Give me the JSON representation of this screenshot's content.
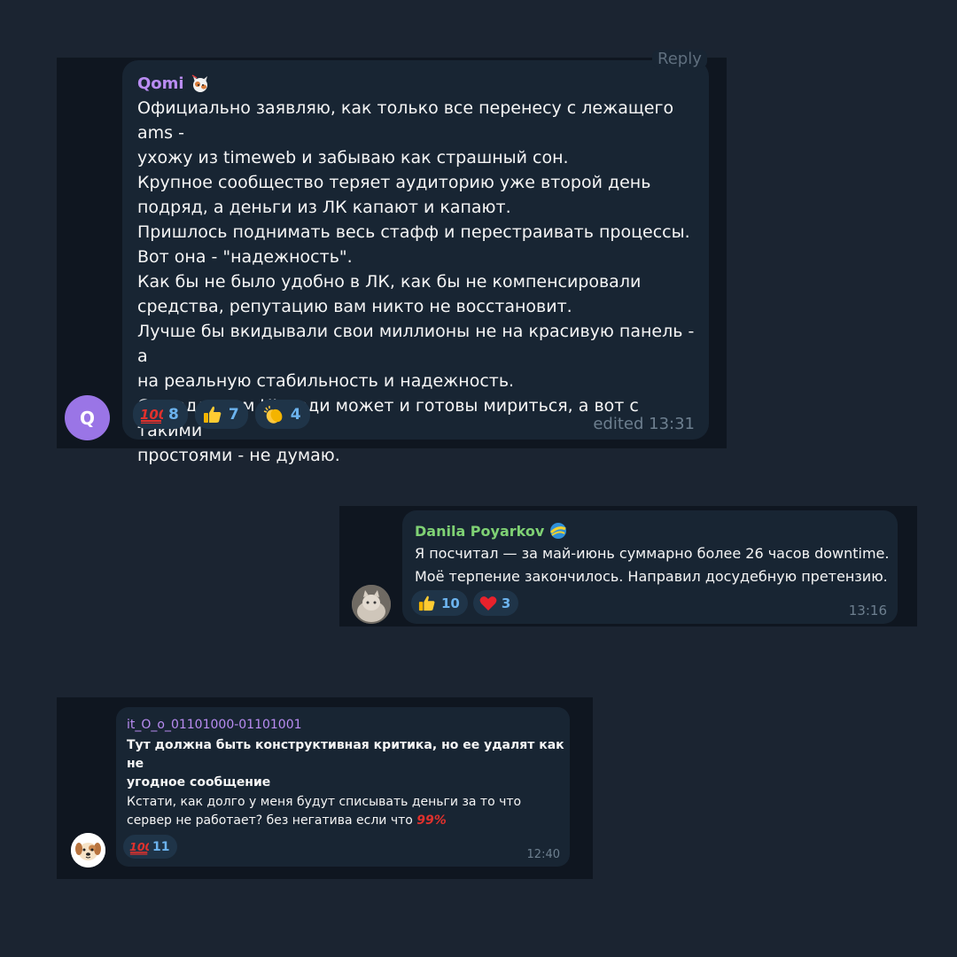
{
  "messages": [
    {
      "author": "Qomi",
      "author_color": "#b98cf2",
      "avatar_letter": "Q",
      "reply_label": "Reply",
      "text": "Официально заявляю, как только все перенесу с лежащего ams -\nухожу из timeweb и забываю как страшный сон.\nКрупное сообщество теряет аудиторию уже второй день\nподряд, а деньги из ЛК капают и капают.\nПришлось поднимать весь стафф и перестраивать процессы.\nВот она - \"надежность\".\nКак бы не было удобно в ЛК, как бы не компенсировали\nсредства, репутацию вам никто не восстановит.\nЛучше бы вкидывали свои миллионы не на красивую панель - а\nна реальную стабильность и надежность.\nС уродливым UI люди может и готовы мириться, а вот с такими\nпростоями - не думаю.",
      "reactions": [
        {
          "emoji": "hundred-points-icon",
          "count": "8"
        },
        {
          "emoji": "thumbs-up-icon",
          "count": "7"
        },
        {
          "emoji": "clapping-hands-icon",
          "count": "4"
        }
      ],
      "time": "edited 13:31"
    },
    {
      "author": "Danila Poyarkov",
      "author_color": "#7fd174",
      "text": "Я посчитал — за май-июнь суммарно более 26 часов downtime.\nМоё терпение закончилось. Направил досудебную претензию.",
      "reactions": [
        {
          "emoji": "thumbs-up-icon",
          "count": "10"
        },
        {
          "emoji": "red-heart-icon",
          "count": "3"
        }
      ],
      "time": "13:16"
    },
    {
      "author": "it_O_o_01101000-01101001",
      "author_color": "#b98cf2",
      "text_bold": "Тут должна быть конструктивная критика, но ее удалят как не\nугодное сообщение",
      "text": "Кстати, как долго у меня будут списывать деньги за то что\nсервер не работает? без негатива если что",
      "text_suffix": "99%",
      "reactions": [
        {
          "emoji": "hundred-points-icon",
          "count": "11"
        }
      ],
      "time": "12:40"
    }
  ],
  "colors": {
    "background": "#1b2431",
    "panel": "#0f1620",
    "bubble": "#182533",
    "reaction_bg": "#1f3448",
    "reaction_count": "#6cb3ee",
    "time": "#6d7f8f",
    "avatar_q": "#9a75e6"
  }
}
